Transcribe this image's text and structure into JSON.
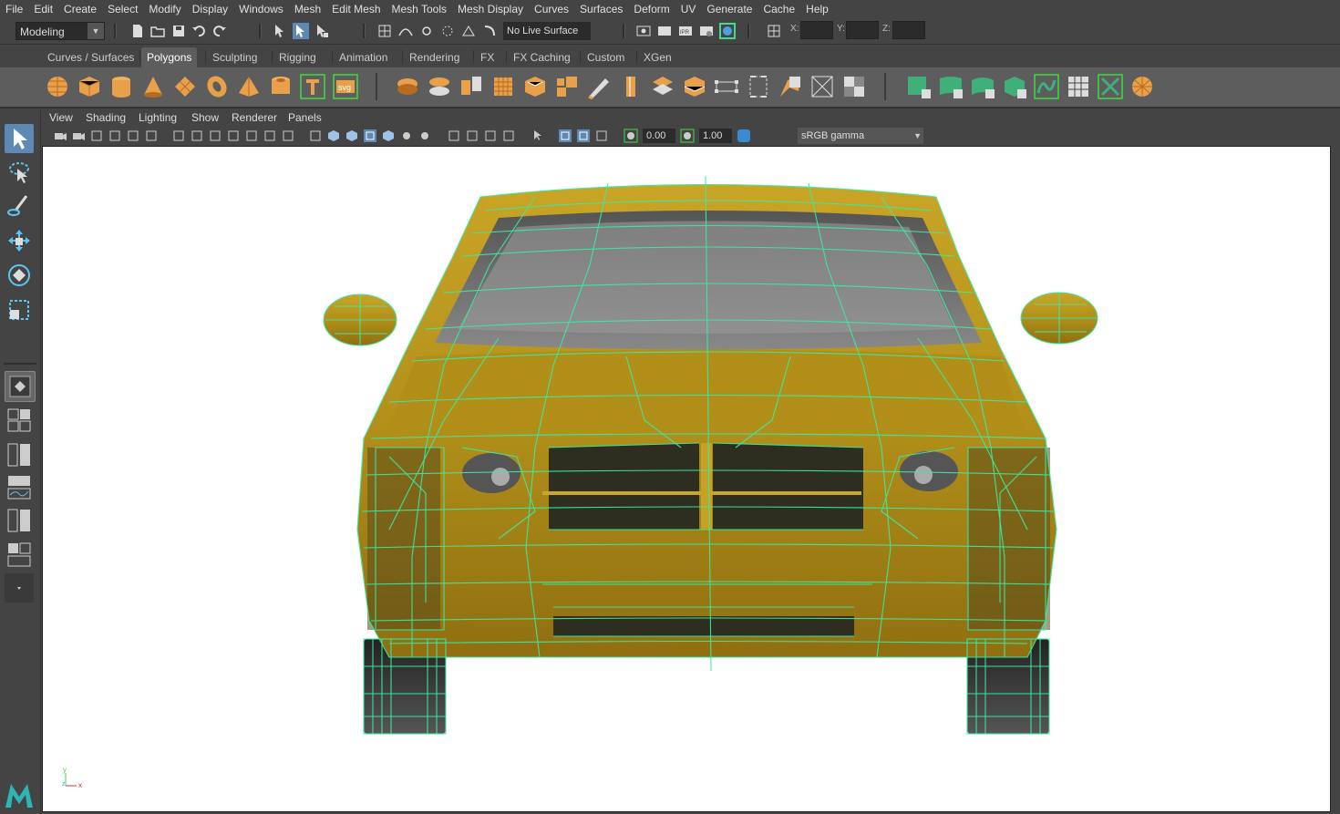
{
  "menubar": [
    "File",
    "Edit",
    "Create",
    "Select",
    "Modify",
    "Display",
    "Windows",
    "Mesh",
    "Edit Mesh",
    "Mesh Tools",
    "Mesh Display",
    "Curves",
    "Surfaces",
    "Deform",
    "UV",
    "Generate",
    "Cache",
    "Help"
  ],
  "statusline": {
    "mode": "Modeling",
    "live_surface": "No Live Surface",
    "x_label": "X:",
    "y_label": "Y:",
    "z_label": "Z:"
  },
  "shelf_tabs": [
    "Curves / Surfaces",
    "Polygons",
    "Sculpting",
    "Rigging",
    "Animation",
    "Rendering",
    "FX",
    "FX Caching",
    "Custom",
    "XGen"
  ],
  "active_shelf_tab": "Polygons",
  "shelf_icons": [
    "poly-sphere-icon",
    "poly-cube-icon",
    "poly-cylinder-icon",
    "poly-cone-icon",
    "poly-plane-icon",
    "poly-torus-icon",
    "poly-pyramid-icon",
    "poly-pipe-icon",
    "type-icon",
    "svg-icon",
    "combine-icon",
    "separate-icon",
    "extract-icon",
    "smooth-icon",
    "bevel-icon",
    "bridge-icon",
    "extrude-icon",
    "multicut-icon",
    "target-weld-icon",
    "edge-loop-icon",
    "insert-loop-icon",
    "fill-hole-icon",
    "merge-icon",
    "boolean-icon",
    "mirror-icon",
    "planar-uv-icon",
    "auto-uv-icon",
    "cylindrical-uv-icon",
    "camera-uv-icon",
    "unfold-icon",
    "uv-editor-icon",
    "cut-sew-icon",
    "retopo-icon"
  ],
  "shelf_svg_label": "svg",
  "panel_menu": [
    "View",
    "Shading",
    "Lighting",
    "Show",
    "Renderer",
    "Panels"
  ],
  "panel_toolbar": {
    "exposure": "0.00",
    "gamma": "1.00",
    "color_space": "sRGB gamma"
  },
  "axis": {
    "y": "y",
    "z": "z",
    "x": "x"
  },
  "colors": {
    "wireframe": "#3ee8a0",
    "car_body": "#b8961c",
    "active_tool": "#5d89b4",
    "viewport_bg": "#ffffff"
  }
}
